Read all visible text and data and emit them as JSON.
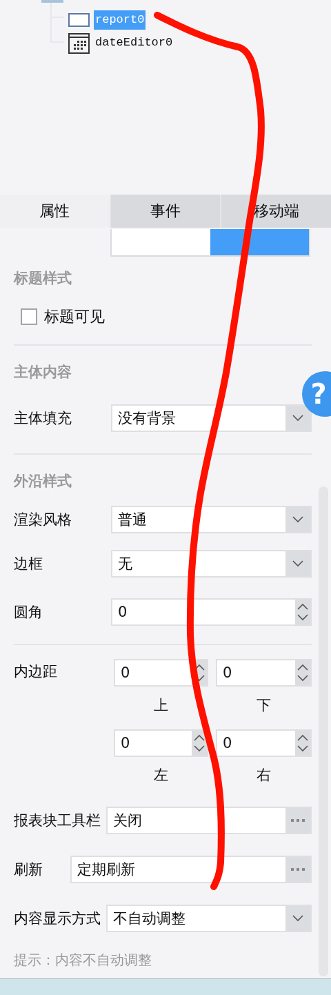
{
  "tree": {
    "items": [
      {
        "label": "report0",
        "kind": "report",
        "selected": true
      },
      {
        "label": "dateEditor0",
        "kind": "calendar",
        "selected": false
      }
    ]
  },
  "tabs": [
    {
      "label": "属性",
      "selected": true
    },
    {
      "label": "事件",
      "selected": false
    },
    {
      "label": "移动端",
      "selected": false
    }
  ],
  "panel": {
    "rows": [
      {
        "kind": "cut-toggle",
        "segments": [
          {
            "selected": false
          },
          {
            "selected": true
          }
        ]
      },
      {
        "kind": "heading",
        "text": "标题样式"
      },
      {
        "kind": "checkbox",
        "label": "标题可见",
        "checked": false
      },
      {
        "kind": "divider"
      },
      {
        "kind": "heading",
        "text": "主体内容"
      },
      {
        "kind": "select",
        "label": "主体填充",
        "value": "没有背景"
      },
      {
        "kind": "divider"
      },
      {
        "kind": "heading",
        "text": "外沿样式"
      },
      {
        "kind": "select",
        "label": "渲染风格",
        "value": "普通"
      },
      {
        "kind": "select",
        "label": "边框",
        "value": "无"
      },
      {
        "kind": "spinner",
        "label": "圆角",
        "value": "0"
      },
      {
        "kind": "divider"
      },
      {
        "kind": "padding",
        "label": "内边距",
        "fields": [
          {
            "value": "0",
            "caption": "上"
          },
          {
            "value": "0",
            "caption": "下"
          },
          {
            "value": "0",
            "caption": "左"
          },
          {
            "value": "0",
            "caption": "右"
          }
        ]
      },
      {
        "kind": "text-button",
        "label": "报表块工具栏",
        "value": "关闭"
      },
      {
        "kind": "text-button",
        "label": "刷新",
        "value": "定期刷新"
      },
      {
        "kind": "select",
        "label": "内容显示方式",
        "value": "不自动调整"
      },
      {
        "kind": "hint",
        "text": "提示：内容不自动调整"
      }
    ]
  },
  "help_button": {
    "label": "?"
  },
  "annotation": {
    "kind": "freehand-stroke"
  }
}
